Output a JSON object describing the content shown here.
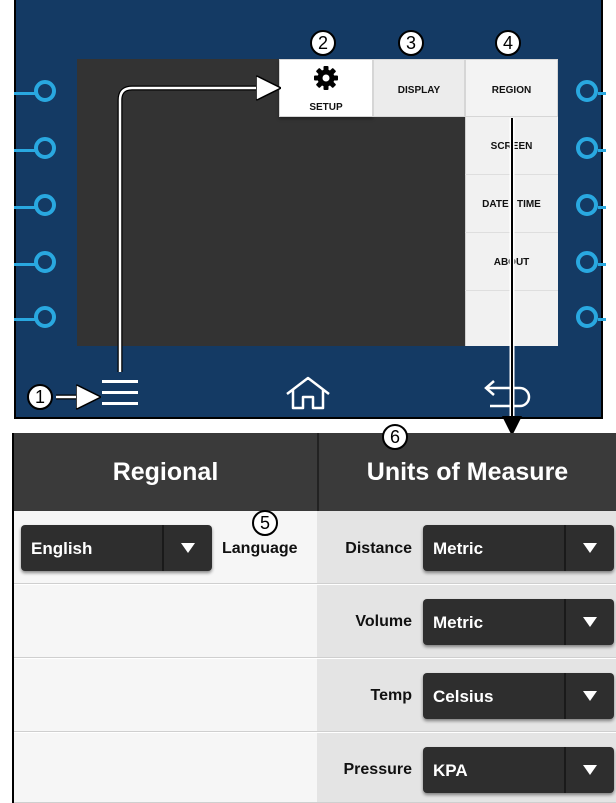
{
  "device": {
    "tabs": [
      {
        "label": "SETUP"
      },
      {
        "label": "DISPLAY"
      },
      {
        "label": "REGION"
      }
    ],
    "submenu": [
      {
        "label": "SCREEN"
      },
      {
        "label": "DATE / TIME"
      },
      {
        "label": "ABOUT"
      }
    ],
    "icons": {
      "setup": "gear-icon",
      "menu": "hamburger-menu-icon",
      "home": "home-icon",
      "back": "back-icon"
    },
    "accent_color": "#29a8e0",
    "frame_color": "#143a64"
  },
  "callouts": [
    "1",
    "2",
    "3",
    "4",
    "5",
    "6"
  ],
  "region_screen": {
    "regional_header": "Regional",
    "units_header": "Units of Measure",
    "language": {
      "value": "English",
      "label": "Language"
    },
    "units": [
      {
        "label": "Distance",
        "value": "Metric"
      },
      {
        "label": "Volume",
        "value": "Metric"
      },
      {
        "label": "Temp",
        "value": "Celsius"
      },
      {
        "label": "Pressure",
        "value": "KPA"
      }
    ]
  }
}
